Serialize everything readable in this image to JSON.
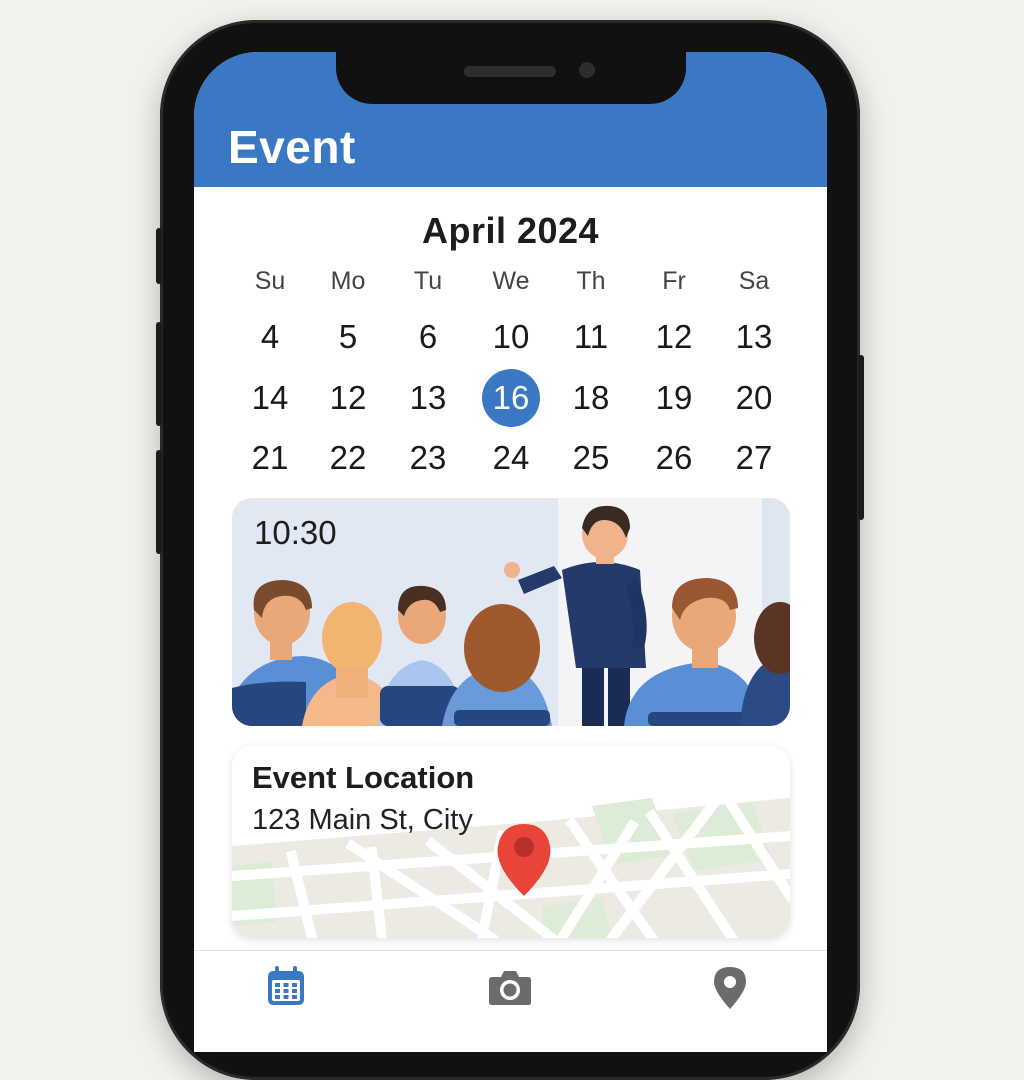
{
  "app": {
    "title": "Event",
    "accent_color": "#3b78c4"
  },
  "calendar": {
    "month_label": "April 2024",
    "weekdays": [
      "Su",
      "Mo",
      "Tu",
      "We",
      "Th",
      "Fr",
      "Sa"
    ],
    "weeks": [
      [
        "4",
        "5",
        "6",
        "10",
        "11",
        "12",
        "13"
      ],
      [
        "14",
        "12",
        "13",
        "16",
        "18",
        "19",
        "20"
      ],
      [
        "21",
        "22",
        "23",
        "24",
        "25",
        "26",
        "27"
      ]
    ],
    "selected_day": "16"
  },
  "event": {
    "time": "10:30",
    "image": "presentation-illustration"
  },
  "location": {
    "title": "Event Location",
    "address": "123 Main St, City",
    "pin_color": "#e8443a"
  },
  "tabbar": {
    "items": [
      {
        "icon": "calendar-icon",
        "active": true
      },
      {
        "icon": "camera-icon",
        "active": false
      },
      {
        "icon": "location-pin-icon",
        "active": false
      }
    ]
  }
}
